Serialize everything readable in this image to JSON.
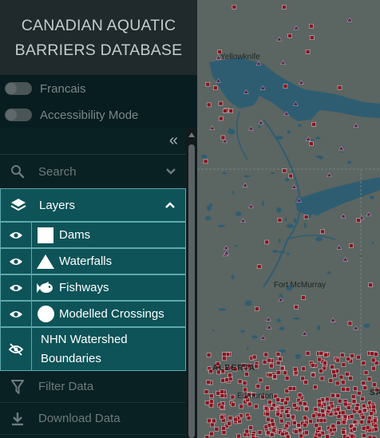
{
  "sidebar": {
    "title_line1": "CANADIAN AQUATIC",
    "title_line2": "BARRIERS DATABASE",
    "toggles": [
      {
        "label": "Francais",
        "on": false
      },
      {
        "label": "Accessibility Mode",
        "on": false
      }
    ],
    "collapse_glyph": "«",
    "search_label": "Search",
    "layers_label": "Layers",
    "layers": [
      {
        "label": "Dams",
        "symbol": "square",
        "visible": true
      },
      {
        "label": "Waterfalls",
        "symbol": "triangle",
        "visible": true
      },
      {
        "label": "Fishways",
        "symbol": "fish",
        "visible": true
      },
      {
        "label": "Modelled Crossings",
        "symbol": "circle",
        "visible": true
      }
    ],
    "watershed_line1": "NHN Watershed",
    "watershed_line2": "Boundaries",
    "watershed_visible": false,
    "filter_label": "Filter Data",
    "download_label": "Download Data"
  },
  "map": {
    "labels": {
      "yellowknife": "Yellowknife",
      "fort_mcmurray": "Fort McMurray",
      "alberta": "ALBERTA",
      "edmonton": "Edmonton",
      "sa": "SA"
    },
    "colors": {
      "land": "#5b6562",
      "water": "#2e5d72",
      "dam": "#8a1420",
      "waterfall": "#5a1f4a"
    }
  }
}
